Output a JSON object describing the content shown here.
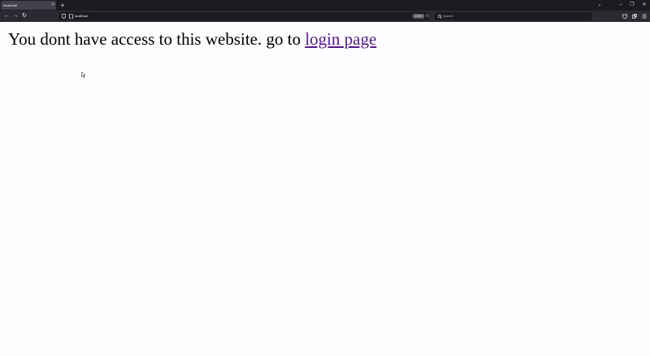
{
  "browser": {
    "tab": {
      "title": "localhost/",
      "close_glyph": "×"
    },
    "new_tab_glyph": "+",
    "window_controls": [
      "⌄",
      "–",
      "❐",
      "✕"
    ],
    "nav": {
      "back": "←",
      "forward": "→",
      "reload": "↻"
    },
    "urlbar": {
      "shield_icon": "shield-icon",
      "page_icon": "page-icon",
      "url": "localhost",
      "zoom": "133%"
    },
    "bookmark_glyph": "☆",
    "search": {
      "placeholder": "Search"
    },
    "toolbar_icons": [
      "pocket-icon",
      "extensions-icon",
      "menu-icon"
    ]
  },
  "page": {
    "message": "You dont have access to this website. go to ",
    "link_text": "login page"
  },
  "colors": {
    "tabstrip_bg": "#1c1b22",
    "toolbar_bg": "#2b2a33",
    "page_bg": "#fdfcff",
    "visited_link": "#551a8b"
  }
}
